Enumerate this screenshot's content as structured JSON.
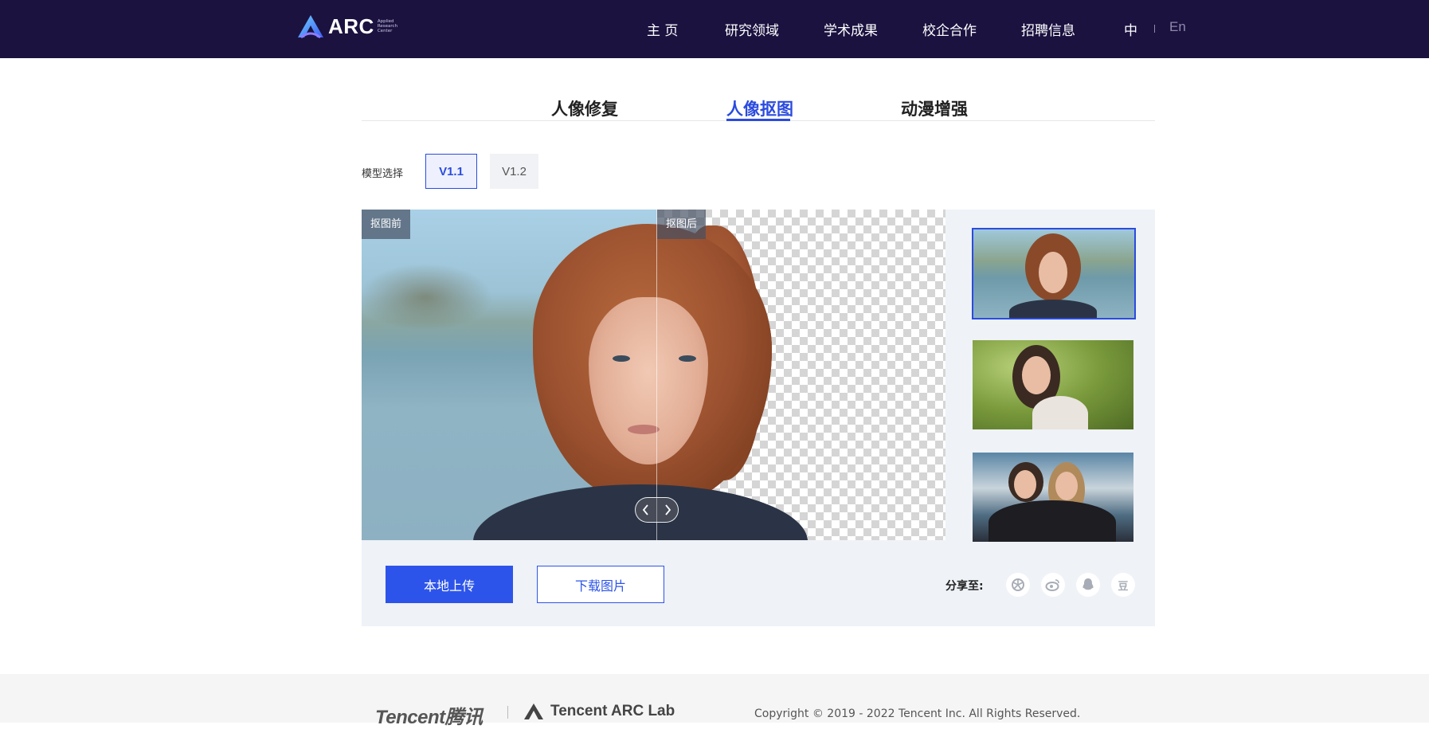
{
  "header": {
    "logo_text": "ARC",
    "logo_sub": [
      "Applied",
      "Research",
      "Center"
    ],
    "nav": [
      "主 页",
      "研究领域",
      "学术成果",
      "校企合作",
      "招聘信息"
    ],
    "lang_zh": "中",
    "lang_en": "En"
  },
  "tabs": [
    {
      "label": "人像修复",
      "active": false
    },
    {
      "label": "人像抠图",
      "active": true
    },
    {
      "label": "动漫增强",
      "active": false
    }
  ],
  "model": {
    "label": "模型选择",
    "options": [
      "V1.1",
      "V1.2"
    ],
    "selected": "V1.1"
  },
  "compare": {
    "before_tag": "抠图前",
    "after_tag": "抠图后",
    "divider_position": 0.506
  },
  "samples": {
    "selected_index": 0,
    "count": 3
  },
  "actions": {
    "upload_label": "本地上传",
    "download_label": "下载图片",
    "share_label": "分享至:",
    "share_targets": [
      "moments-icon",
      "weibo-icon",
      "qq-icon",
      "douban-icon"
    ],
    "douban_glyph": "豆"
  },
  "footer": {
    "tencent": "Tencent腾讯",
    "arc_lab": "Tencent  ARC Lab",
    "copyright": "Copyright © 2019 - 2022 Tencent Inc. All Rights Reserved."
  },
  "colors": {
    "header_bg": "#1b1240",
    "accent": "#2d54ea",
    "panel_bg": "#eff2f7"
  }
}
